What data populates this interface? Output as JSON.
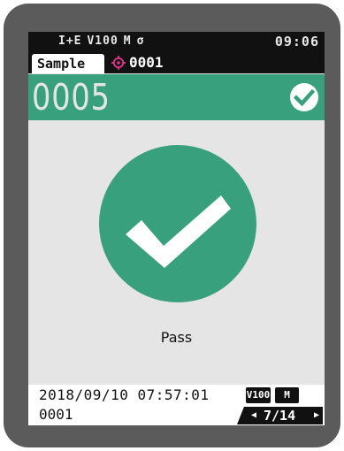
{
  "status_bar": {
    "indicators": [
      "I+E",
      "V100",
      "M",
      "σ"
    ],
    "time": "09:06"
  },
  "tab": {
    "sample_label": "Sample",
    "target_icon": "target-icon",
    "target_number": "0001"
  },
  "header": {
    "sample_number": "0005",
    "result_icon": "check-circle-icon"
  },
  "result": {
    "icon": "check-icon",
    "label": "Pass",
    "color": "#38a07d"
  },
  "footer": {
    "timestamp": "2018/09/10 07:57:01",
    "target_sample": "0001",
    "badges": [
      "V100",
      "M"
    ],
    "page": "7/14"
  },
  "colors": {
    "accent": "#38a07d",
    "target": "#e0368c",
    "bezel": "#5b5b5b",
    "screen": "#e5e5e5"
  }
}
